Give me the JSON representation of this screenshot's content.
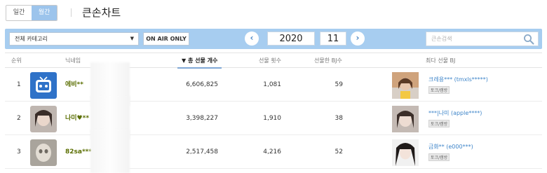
{
  "header": {
    "period_tabs": [
      "일간",
      "월간"
    ],
    "active_period": "월간",
    "title": "큰손차트"
  },
  "filters": {
    "category": "전체 카테고리",
    "onair_label": "ON AIR ONLY",
    "year": "2020",
    "month": "11",
    "search_placeholder": "큰손검색"
  },
  "table": {
    "columns": [
      "순위",
      "닉네임",
      "▼ 총 선물 개수",
      "선물 횟수",
      "선물한 BJ수",
      "최다 선물 BJ"
    ],
    "sorted_column": "▼ 총 선물 개수",
    "rows": [
      {
        "rank": "1",
        "nickname": "에비**",
        "total_gifts": "6,606,825",
        "gift_count": "1,081",
        "bj_count": "59",
        "top_bj_name": "크레용*** (tmxls*****)",
        "top_bj_tag": "토크/캠방"
      },
      {
        "rank": "2",
        "nickname": "나미♥**",
        "total_gifts": "3,398,227",
        "gift_count": "1,910",
        "bj_count": "38",
        "top_bj_name": "***|나미 (apple****)",
        "top_bj_tag": "토크/캠방"
      },
      {
        "rank": "3",
        "nickname": "82sa***",
        "total_gifts": "2,517,458",
        "gift_count": "4,216",
        "bj_count": "52",
        "top_bj_name": "금화** (e000***)",
        "top_bj_tag": "토크/캠방"
      }
    ]
  },
  "colors": {
    "accent": "#9cc4ec",
    "filter_bar": "#a7cdf0",
    "nickname": "#5a6e00",
    "link": "#3e85c9"
  },
  "icons": [
    "search-icon",
    "chevron-left-icon",
    "chevron-right-icon",
    "caret-down-icon"
  ]
}
